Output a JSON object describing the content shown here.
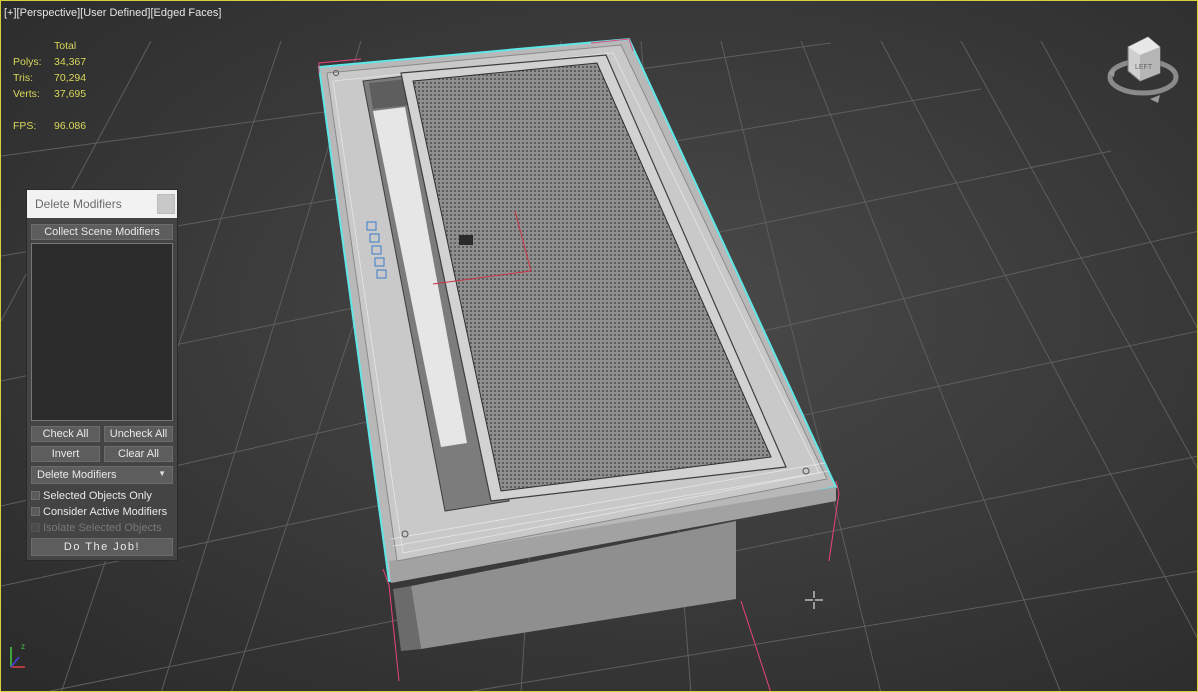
{
  "viewport": {
    "labels": [
      "[+]",
      "[Perspective]",
      "[User Defined]",
      "[Edged Faces]"
    ],
    "border_color": "#d8d23a"
  },
  "stats": {
    "header": "Total",
    "polys_label": "Polys:",
    "polys": "34,367",
    "tris_label": "Tris:",
    "tris": "70,294",
    "verts_label": "Verts:",
    "verts": "37,695",
    "fps_label": "FPS:",
    "fps": "96.086",
    "color": "#d9d75a"
  },
  "panel": {
    "title": "Delete Modifiers",
    "collect_label": "Collect Scene Modifiers",
    "check_all": "Check All",
    "uncheck_all": "Uncheck All",
    "invert": "Invert",
    "clear_all": "Clear All",
    "mode_selected": "Delete Modifiers",
    "opt_selected_only": "Selected Objects Only",
    "opt_consider_active": "Consider Active Modifiers",
    "opt_isolate": "Isolate Selected Objects",
    "do_job": "Do The Job!"
  },
  "viewcube": {
    "face_label": "LEFT"
  },
  "icons": {
    "viewcube": "viewcube-icon",
    "axis": "axis-tripod-icon",
    "cursor": "move-cursor-icon",
    "close": "close-icon",
    "dropdown": "chevron-down-icon"
  },
  "colors": {
    "selection": "#5fe6e6",
    "bbox": "#e8447a"
  }
}
